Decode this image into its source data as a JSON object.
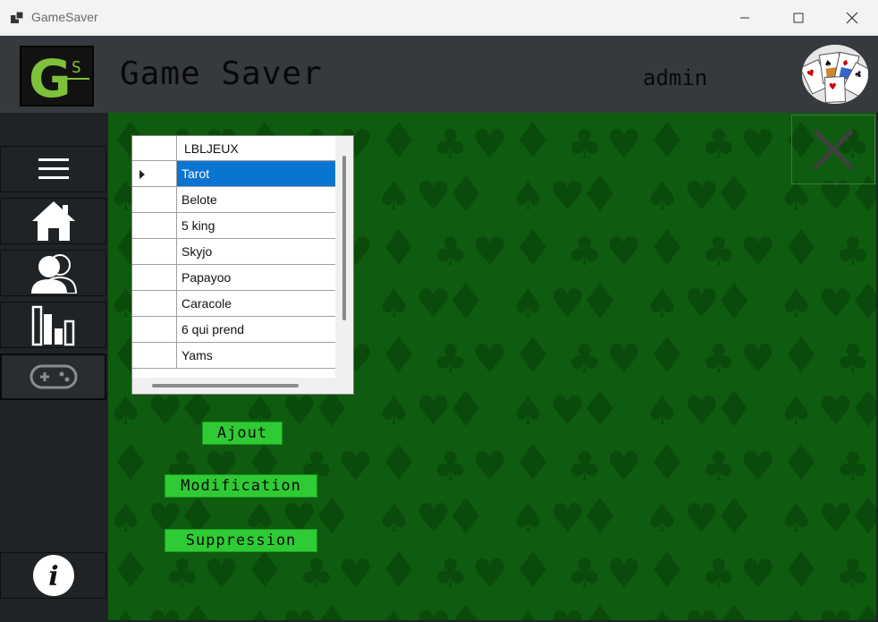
{
  "window": {
    "title": "GameSaver",
    "controls": [
      "minimize-icon",
      "maximize-icon",
      "close-icon"
    ]
  },
  "header": {
    "logo_letter": "G",
    "logo_sub": "S",
    "app_title": "Game Saver",
    "username": "admin",
    "avatar_icon": "playing-cards-icon"
  },
  "sidebar": {
    "items": [
      {
        "icon": "hamburger-menu-icon"
      },
      {
        "icon": "home-icon"
      },
      {
        "icon": "users-icon"
      },
      {
        "icon": "bar-chart-icon"
      },
      {
        "icon": "gamepad-icon",
        "active": true
      },
      {
        "icon": "info-icon"
      }
    ]
  },
  "grid": {
    "column_header": "LBLJEUX",
    "rows": [
      "Tarot",
      "Belote",
      "5 king",
      "Skyjo",
      "Papayoo",
      "Caracole",
      "6 qui prend",
      "Yams"
    ],
    "selected_index": 0
  },
  "actions": {
    "add_label": "Ajout",
    "modify_label": "Modification",
    "delete_label": "Suppression"
  },
  "colors": {
    "background_green": "#0f5b0f",
    "suit_pattern": "#0a4a0a",
    "button_green": "#2fcb34",
    "selection_blue": "#0a74d1",
    "header_dark": "#36393d",
    "sidebar_dark": "#1f2326"
  }
}
